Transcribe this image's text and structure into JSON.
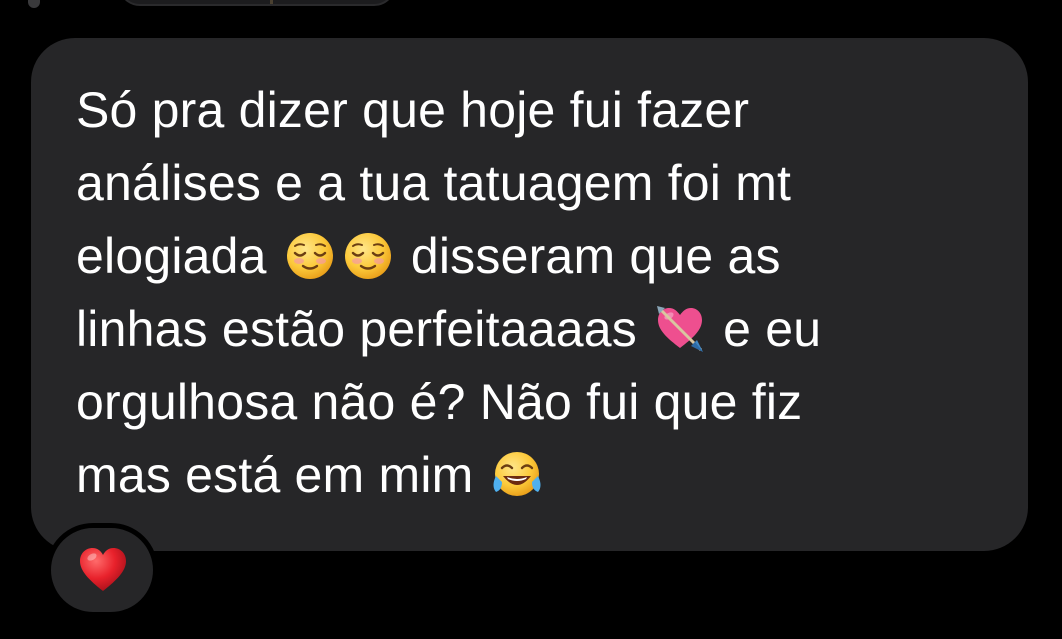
{
  "message": {
    "lines": [
      {
        "segments": [
          {
            "text": "Só pra dizer que hoje fui fazer"
          }
        ]
      },
      {
        "segments": [
          {
            "text": "análises e a tua tatuagem foi mt"
          }
        ]
      },
      {
        "segments": [
          {
            "text": "elogiada "
          },
          {
            "emoji": "relieved-face-emoji"
          },
          {
            "emoji": "relieved-face-emoji"
          },
          {
            "text": " disseram que as"
          }
        ]
      },
      {
        "segments": [
          {
            "text": "linhas estão perfeitaaaas "
          },
          {
            "emoji": "heart-with-arrow-emoji"
          },
          {
            "text": " e eu"
          }
        ]
      },
      {
        "segments": [
          {
            "text": "orgulhosa não é? Não fui que fiz"
          }
        ]
      },
      {
        "segments": [
          {
            "text": "mas está em mim "
          },
          {
            "emoji": "tears-of-joy-emoji"
          }
        ]
      }
    ]
  },
  "reaction": {
    "icon": "red-heart-icon",
    "color": "#e8212b"
  },
  "colors": {
    "background": "#000000",
    "bubble": "#262628",
    "text": "#ffffff"
  }
}
